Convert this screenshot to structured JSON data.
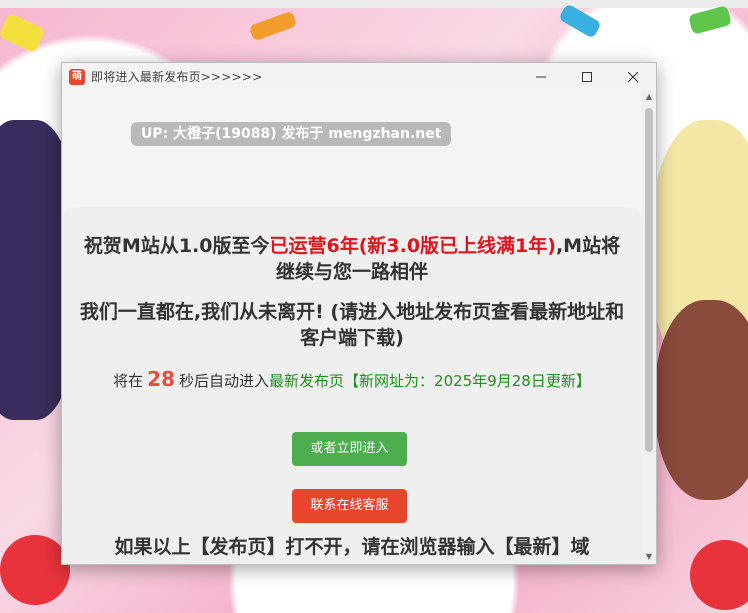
{
  "window": {
    "title": "即将进入最新发布页>>>>>>",
    "app_icon_glyph": "萌",
    "controls": {
      "minimize": "—",
      "maximize": "☐",
      "close": "✕"
    }
  },
  "page": {
    "up_pill": "UP: 大橙子(19088) 发布于 mengzhan.net",
    "headline1_part1": "祝贺M站从1.0版至今",
    "headline1_red": "已运营6年(新3.0版已上线满1年)",
    "headline1_part2": ",M站将继续与您一路相伴",
    "headline2": "我们一直都在,我们从未离开! (请进入地址发布页查看最新地址和客户端下载)",
    "countdown_prefix": "将在",
    "countdown_number": "28",
    "countdown_middle": "秒后自动进入",
    "countdown_link": "最新发布页",
    "countdown_note": "【新网址为：2025年9月28日更新】",
    "enter_button": "或者立即进入",
    "service_button": "联系在线客服",
    "bottom_text": "如果以上【发布页】打不开，请在浏览器输入【最新】域"
  },
  "colors": {
    "accent_red": "#e0141a",
    "button_green": "#4cae4c",
    "button_red": "#e8462c",
    "link_green": "#1e8f1e"
  }
}
